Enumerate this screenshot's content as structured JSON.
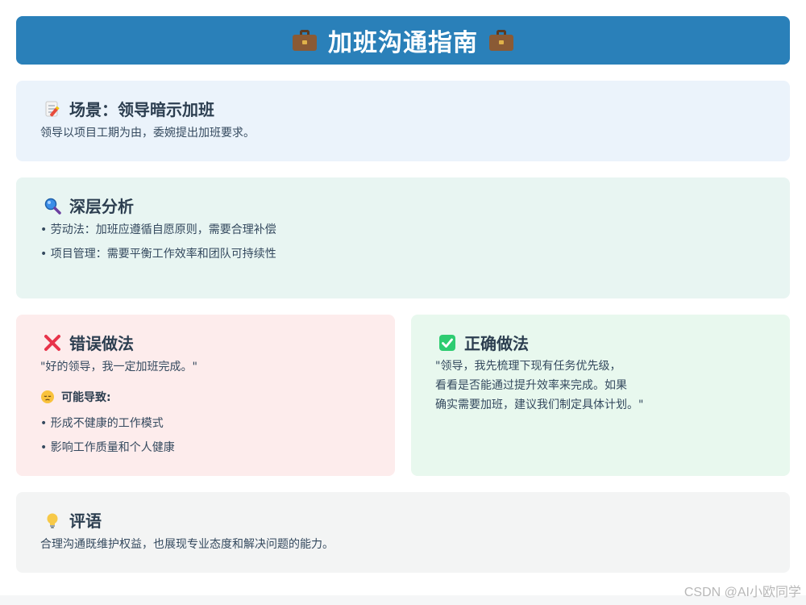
{
  "header": {
    "title": "加班沟通指南"
  },
  "scene": {
    "title": "场景：领导暗示加班",
    "text": "领导以项目工期为由，委婉提出加班要求。"
  },
  "analysis": {
    "title": "深层分析",
    "bullets": [
      "• 劳动法：加班应遵循自愿原则，需要合理补偿",
      "• 项目管理：需要平衡工作效率和团队可持续性"
    ]
  },
  "wrong": {
    "title": "错误做法",
    "quote": "\"好的领导，我一定加班完成。\"",
    "consequence_title": "可能导致:",
    "bullets": [
      "• 形成不健康的工作模式",
      "• 影响工作质量和个人健康"
    ]
  },
  "right": {
    "title": "正确做法",
    "lines": [
      "\"领导，我先梳理下现有任务优先级，",
      "看看是否能通过提升效率来完成。如果",
      "确实需要加班，建议我们制定具体计划。\""
    ]
  },
  "comment": {
    "title": "评语",
    "text": "合理沟通既维护权益，也展现专业态度和解决问题的能力。"
  },
  "watermark": "CSDN @AI小欧同学",
  "colors": {
    "header": "#2a80b9",
    "scene_bg": "#ebf3fb",
    "analysis_bg": "#e8f5f2",
    "wrong_bg": "#fdecec",
    "right_bg": "#e8f8ee",
    "comment_bg": "#f3f4f4"
  },
  "icons": [
    "briefcase-icon",
    "memo-icon",
    "magnifier-icon",
    "cross-mark-icon",
    "check-mark-icon",
    "pensive-face-icon",
    "light-bulb-icon"
  ]
}
